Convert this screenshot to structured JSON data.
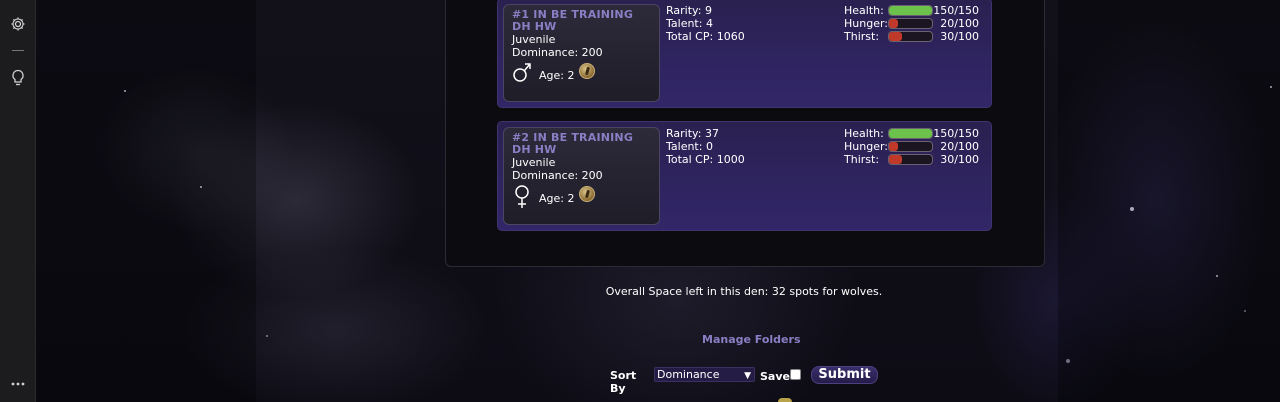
{
  "colors": {
    "accent": "#8a7fc4",
    "health": "#6cc24a",
    "hunger": "#c0392b",
    "thirst": "#c0392b"
  },
  "rail": {
    "settings_icon": "gear-icon",
    "tips_icon": "lightbulb-icon",
    "more_icon": "more-dots-icon"
  },
  "wolves": [
    {
      "name": "#1 IN BE TRAINING DH HW",
      "stage": "Juvenile",
      "dominance": "Dominance: 200",
      "gender": "male",
      "age": "Age: 2",
      "rarity": "Rarity: 9",
      "talent": "Talent: 4",
      "total_cp": "Total CP: 1060",
      "health_label": "Health:",
      "health_value": "150/150",
      "health_fraction": 1.0,
      "hunger_label": "Hunger:",
      "hunger_value": "20/100",
      "hunger_fraction": 0.2,
      "thirst_label": "Thirst:",
      "thirst_value": "30/100",
      "thirst_fraction": 0.3
    },
    {
      "name": "#2 IN BE TRAINING DH HW",
      "stage": "Juvenile",
      "dominance": "Dominance: 200",
      "gender": "female",
      "age": "Age: 2",
      "rarity": "Rarity: 37",
      "talent": "Talent: 0",
      "total_cp": "Total CP: 1000",
      "health_label": "Health:",
      "health_value": "150/150",
      "health_fraction": 1.0,
      "hunger_label": "Hunger:",
      "hunger_value": "20/100",
      "hunger_fraction": 0.2,
      "thirst_label": "Thirst:",
      "thirst_value": "30/100",
      "thirst_fraction": 0.3
    }
  ],
  "den": {
    "space_left": "Overall Space left in this den: 32 spots for wolves.",
    "manage_folders": "Manage Folders"
  },
  "sort": {
    "label": "Sort By",
    "selected": "Dominance",
    "save_label": "Save",
    "save_checked": false,
    "submit_label": "Submit"
  }
}
